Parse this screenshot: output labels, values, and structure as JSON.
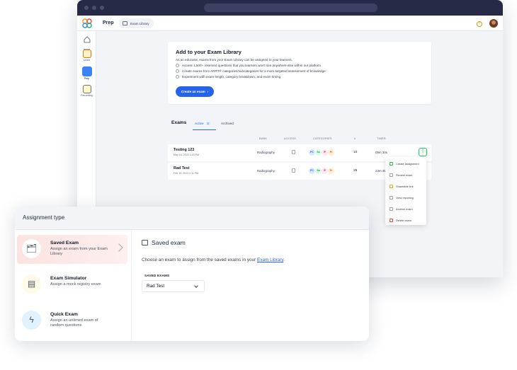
{
  "app": {
    "title": "Prep",
    "breadcrumb": "Exam Library"
  },
  "sidebar": {
    "items": [
      {
        "label": "Home",
        "icon": "home-icon"
      },
      {
        "label": "Learn",
        "icon": "learn-icon"
      },
      {
        "label": "Prep",
        "icon": "prep-icon",
        "active": true
      },
      {
        "label": "Recording",
        "icon": "recording-icon"
      }
    ]
  },
  "add_card": {
    "title": "Add to your Exam Library",
    "description": "As an educator, exams from your Exam Library can be assigned to your learners.",
    "bullets": [
      "Access 1,500+ reserved questions that you learners won't see anywhere else within our platform",
      "Create exams from ARRT® categories/subcategories for a more targeted assessment of knowledge",
      "Experiment with exam length, category breakdown, and exam timing"
    ],
    "button": "Create an exam"
  },
  "exams": {
    "title": "Exams",
    "tabs": {
      "active_label": "Active",
      "active_count": "2",
      "archived_label": "Archived"
    },
    "columns": {
      "bank": "BANK",
      "access": "ACCESS",
      "categories": "CATEGORIES",
      "questions": "#",
      "timer": "TIMER"
    },
    "rows": [
      {
        "name": "Testing 123",
        "date": "May 16, 2023 3:23 PM",
        "bank": "Radiography",
        "cats": [
          "PC",
          "Sa",
          "IP",
          "Pr"
        ],
        "count": "10",
        "timer": "09m 30s"
      },
      {
        "name": "Rad Test",
        "date": "Feb 15, 2023 2:11 PM",
        "bank": "Radiography",
        "cats": [
          "PC",
          "Sa",
          "IP",
          "Pr"
        ],
        "count": "25",
        "timer": "23m 45s"
      }
    ]
  },
  "menu": {
    "items": [
      "Create assignment",
      "Review exam",
      "Shareable link",
      "View reporting",
      "Archive exam",
      "Delete exam"
    ]
  },
  "panel": {
    "title": "Assignment type",
    "types": [
      {
        "name": "Saved Exam",
        "desc": "Assign an exam from your Exam Library",
        "icon": "saved-exam-icon"
      },
      {
        "name": "Exam Simulator",
        "desc": "Assign a mock registry exam",
        "icon": "simulator-icon"
      },
      {
        "name": "Quick Exam",
        "desc": "Assign an untimed exam of random questions",
        "icon": "lightning-icon"
      }
    ],
    "detail_title": "Saved exam",
    "detail_desc_prefix": "Choose an exam to assign from the saved exams in your ",
    "detail_link": "Exam Library",
    "detail_desc_suffix": ".",
    "saved_label": "SAVED EXAMS",
    "selected_exam": "Rad Test"
  },
  "colors": {
    "accent": "#2563eb",
    "chrome": "#262a47",
    "selected_bg": "#fbe3e1"
  }
}
